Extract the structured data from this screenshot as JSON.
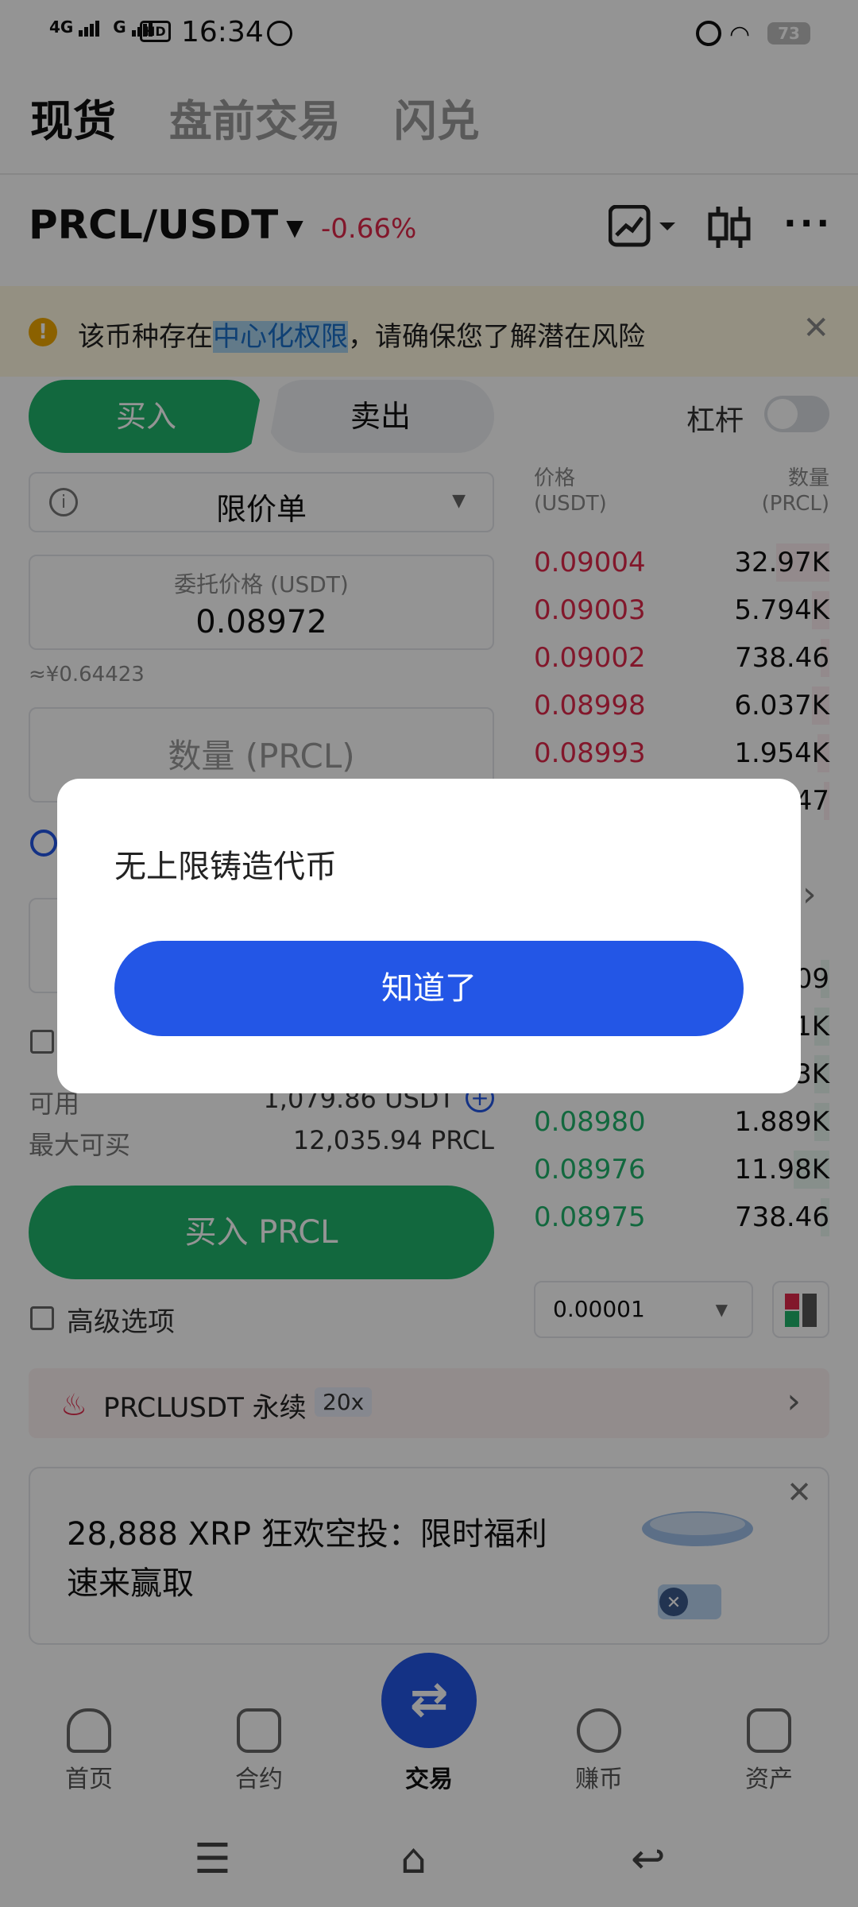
{
  "status_bar": {
    "network_1": "4G",
    "network_2": "G",
    "hd": "HD",
    "time": "16:34",
    "battery": "73"
  },
  "top_tabs": [
    {
      "label": "现货",
      "active": true
    },
    {
      "label": "盘前交易",
      "active": false
    },
    {
      "label": "闪兑",
      "active": false
    }
  ],
  "pair": {
    "symbol": "PRCL/USDT",
    "change": "-0.66%"
  },
  "warning": {
    "text_before": "该币种存在",
    "highlight": "中心化权限",
    "text_after": "，请确保您了解潜在风险"
  },
  "trade_side": {
    "buy": "买入",
    "sell": "卖出",
    "leverage": "杠杆"
  },
  "form": {
    "order_type": "限价单",
    "price_label": "委托价格 (USDT)",
    "price_value": "0.08972",
    "approx": "≈¥0.64423",
    "quantity_placeholder": "数量 (PRCL)",
    "available_label": "可用",
    "available_value": "1,079.86 USDT",
    "max_buy_label": "最大可买",
    "max_buy_value": "12,035.94 PRCL",
    "buy_button": "买入 PRCL",
    "advanced": "高级选项"
  },
  "order_book": {
    "price_header": "价格\n(USDT)",
    "qty_header": "数量\n(PRCL)",
    "asks": [
      {
        "price": "0.09004",
        "qty": "32.97K",
        "depth": 0.18
      },
      {
        "price": "0.09003",
        "qty": "5.794K",
        "depth": 0.06
      },
      {
        "price": "0.09002",
        "qty": "738.46",
        "depth": 0.03
      },
      {
        "price": "0.08998",
        "qty": "6.037K",
        "depth": 0.06
      },
      {
        "price": "0.08993",
        "qty": "1.954K",
        "depth": 0.04
      },
      {
        "price": "",
        "qty": "47",
        "depth": 0.02
      }
    ],
    "arrow": "›",
    "bids_partial": [
      {
        "price": "",
        "qty": "09",
        "depth": 0.03
      },
      {
        "price": "",
        "qty": "1K",
        "depth": 0.05
      },
      {
        "price": "",
        "qty": "3K",
        "depth": 0.05
      }
    ],
    "bids": [
      {
        "price": "0.08980",
        "qty": "1.889K",
        "depth": 0.05
      },
      {
        "price": "0.08976",
        "qty": "11.98K",
        "depth": 0.12
      },
      {
        "price": "0.08975",
        "qty": "738.46",
        "depth": 0.03
      }
    ],
    "precision": "0.00001"
  },
  "perp": {
    "label": "PRCLUSDT 永续",
    "leverage": "20x"
  },
  "promo": {
    "text": "28,888 XRP 狂欢空投：限时福利速来赢取"
  },
  "bottom_nav": [
    {
      "label": "首页"
    },
    {
      "label": "合约"
    },
    {
      "label": "交易"
    },
    {
      "label": "赚币"
    },
    {
      "label": "资产"
    }
  ],
  "dialog": {
    "message": "无上限铸造代币",
    "confirm": "知道了"
  },
  "colors": {
    "up": "#1fb36b",
    "down": "#e0294a",
    "accent": "#2356e6"
  }
}
